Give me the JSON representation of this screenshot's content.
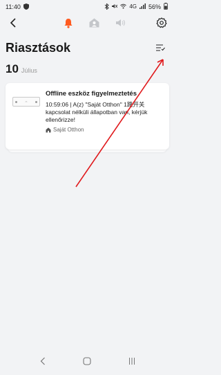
{
  "status_bar": {
    "time": "11:40",
    "battery_percent": "56%",
    "network": "4G"
  },
  "nav": {
    "active_tab": "alerts",
    "accent_color": "#ff5a1f"
  },
  "page": {
    "title": "Riasztások"
  },
  "date_group": {
    "day": "10",
    "month": "Július"
  },
  "alerts": [
    {
      "title": "Offline eszköz figyelmeztetés",
      "message": "10:59:06 | A(z) \"Saját Otthon\" 1路开关 kapcsolat nélküli állapotban van, kérjük ellenőrizze!",
      "home": "Saját Otthon",
      "device_icon": "switch-device-icon"
    }
  ],
  "annotation": {
    "color": "#e0191c"
  }
}
